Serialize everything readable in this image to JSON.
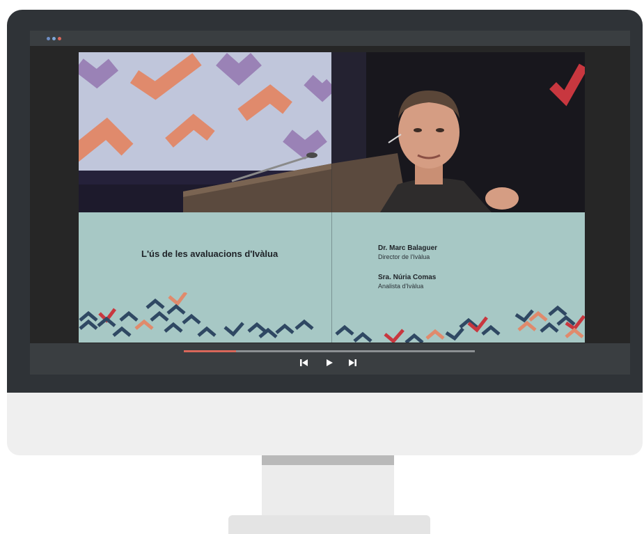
{
  "colors": {
    "monitor_frame": "#2f3337",
    "monitor_chin": "#efefef",
    "slide_background": "#a7c8c5",
    "chevron_navy": "#2f4863",
    "chevron_red": "#c8373f",
    "chevron_orange": "#e08a6c",
    "progress_fill": "#d9675a"
  },
  "window": {
    "controls": [
      "close-dot",
      "minimize-dot",
      "maximize-dot"
    ]
  },
  "slide": {
    "title": "L'ús de les avaluacions d'Ivàlua",
    "speakers": [
      {
        "name": "Dr. Marc Balaguer",
        "role": "Director de l'Ivàlua"
      },
      {
        "name": "Sra. Núria Comas",
        "role": "Analista d'Ivàlua"
      }
    ]
  },
  "player": {
    "progress": 0.18,
    "icons": [
      "skip-back-icon",
      "play-icon",
      "skip-forward-icon"
    ]
  }
}
